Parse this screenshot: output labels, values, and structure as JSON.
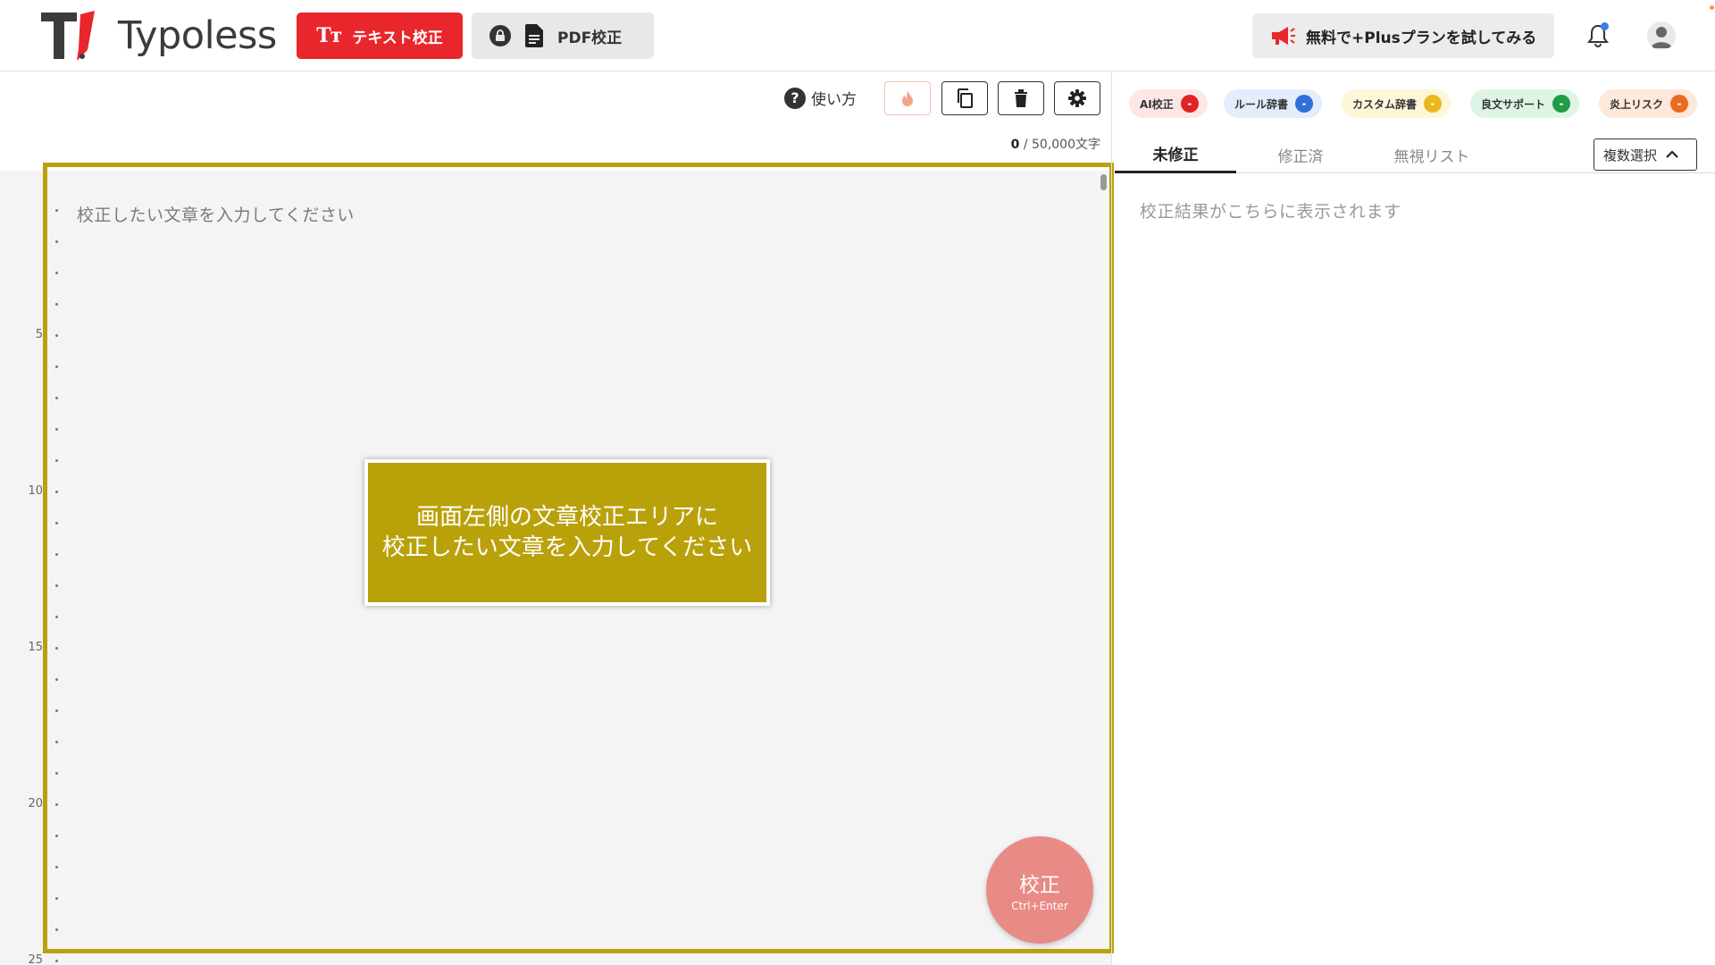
{
  "header": {
    "logo_text": "Typoless",
    "text_check_label": "テキスト校正",
    "text_check_icon": "Tт",
    "pdf_check_label": "PDF校正",
    "plus_trial_label": "無料で+Plusプランを試してみる"
  },
  "editor_toolbar": {
    "help_label": "使い方",
    "char_count_current": "0",
    "char_count_max": "/ 50,000文字"
  },
  "editor": {
    "placeholder": "校正したい文章を入力してください",
    "line_numbers": [
      "5",
      "10",
      "15",
      "20",
      "25"
    ],
    "tooltip_line1": "画面左側の文章校正エリアに",
    "tooltip_line2": "校正したい文章を入力してください",
    "proofread_label": "校正",
    "proofread_shortcut": "Ctrl+Enter"
  },
  "filters": [
    {
      "label": "AI校正",
      "count": "-",
      "bg": "#fde7e6",
      "dot": "#e02323"
    },
    {
      "label": "ルール辞書",
      "count": "-",
      "bg": "#e4edfb",
      "dot": "#2f6fd8"
    },
    {
      "label": "カスタム辞書",
      "count": "-",
      "bg": "#fdf6d8",
      "dot": "#e9b81c"
    },
    {
      "label": "良文サポート",
      "count": "-",
      "bg": "#def5e5",
      "dot": "#1f9c48"
    },
    {
      "label": "炎上リスク",
      "count": "-",
      "bg": "#fde8da",
      "dot": "#ea6a22"
    }
  ],
  "result_tabs": [
    {
      "label": "未修正"
    },
    {
      "label": "修正済"
    },
    {
      "label": "無視リスト"
    }
  ],
  "multi_select_label": "複数選択",
  "results_placeholder": "校正結果がこちらに表示されます",
  "colors": {
    "brand_red": "#e8262b",
    "highlight_gold": "#b9a10a",
    "proof_button": "#e88a86"
  }
}
